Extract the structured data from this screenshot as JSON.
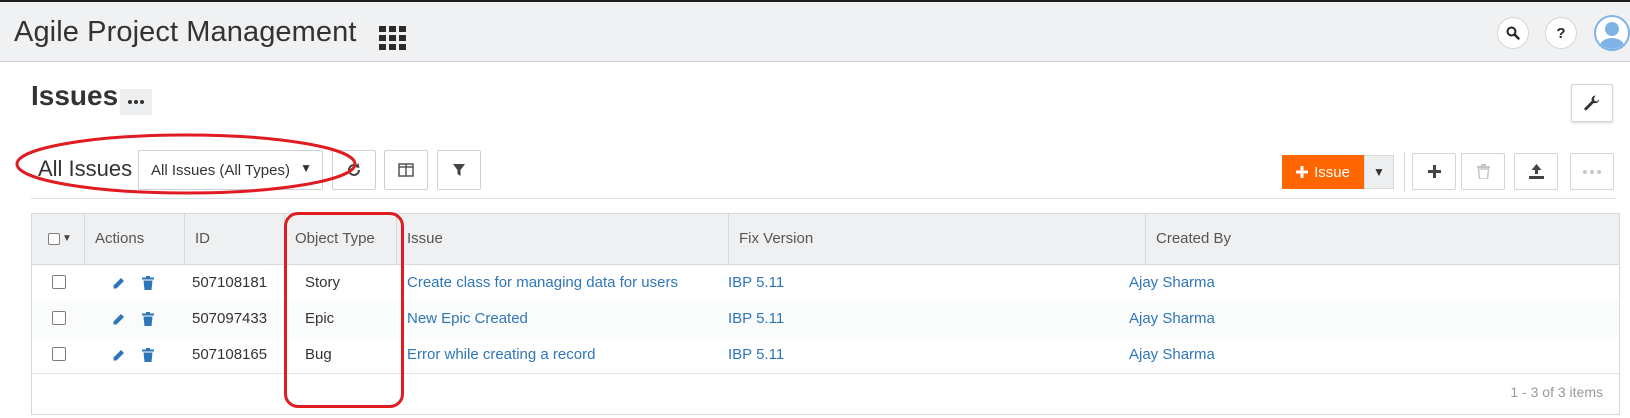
{
  "app": {
    "title": "Agile Project Management"
  },
  "header": {
    "icons": [
      "apps-grid-icon",
      "search-icon",
      "help-icon",
      "user-avatar-icon"
    ],
    "help_label": "?"
  },
  "page": {
    "title": "Issues"
  },
  "toolbar": {
    "view_label": "All Issues",
    "view_select_value": "All Issues (All Types)",
    "add_issue_label": "Issue",
    "accent_color": "#ff6600"
  },
  "table": {
    "columns": [
      "Actions",
      "ID",
      "Object Type",
      "Issue",
      "Fix Version",
      "Created By"
    ],
    "rows": [
      {
        "id": "507108181",
        "object_type": "Story",
        "issue": "Create class for managing data for users",
        "fix_version": "IBP 5.11",
        "created_by": "Ajay Sharma"
      },
      {
        "id": "507097433",
        "object_type": "Epic",
        "issue": "New Epic Created",
        "fix_version": "IBP 5.11",
        "created_by": "Ajay Sharma"
      },
      {
        "id": "507108165",
        "object_type": "Bug",
        "issue": "Error while creating a record",
        "fix_version": "IBP 5.11",
        "created_by": "Ajay Sharma"
      }
    ],
    "footer_count": "1 - 3 of 3 items"
  }
}
